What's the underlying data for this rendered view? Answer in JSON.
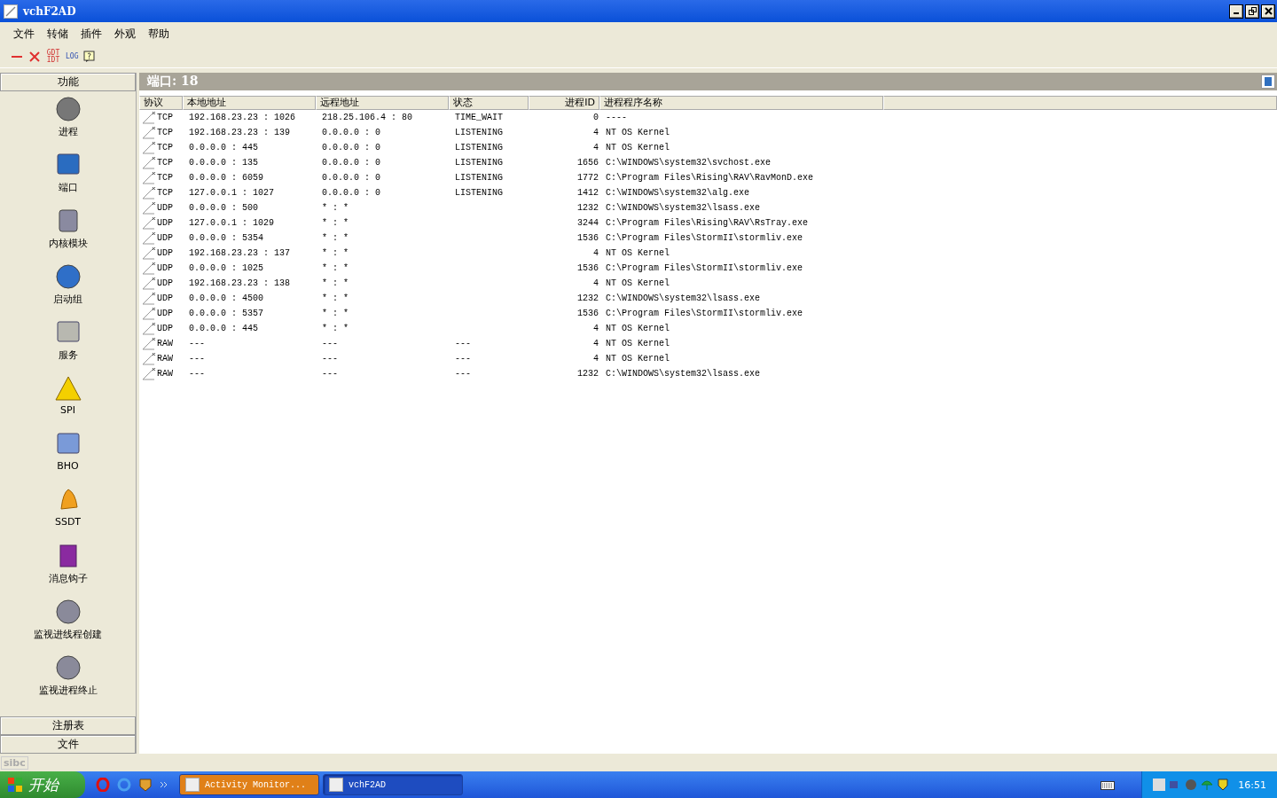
{
  "window": {
    "title": "vchF2AD"
  },
  "menu": [
    "文件",
    "转储",
    "插件",
    "外观",
    "帮助"
  ],
  "toolbar": [
    {
      "kind": "minus"
    },
    {
      "kind": "cross"
    },
    {
      "kind": "text",
      "label": "GDT IDT"
    },
    {
      "kind": "text",
      "label": "LOG"
    },
    {
      "kind": "help"
    }
  ],
  "sidebar": {
    "header": "功能",
    "items": [
      {
        "label": "进程",
        "kind": "gear"
      },
      {
        "label": "端口",
        "kind": "network"
      },
      {
        "label": "内核模块",
        "kind": "drive"
      },
      {
        "label": "启动组",
        "kind": "globe"
      },
      {
        "label": "服务",
        "kind": "computer"
      },
      {
        "label": "SPI",
        "kind": "warning"
      },
      {
        "label": "BHO",
        "kind": "folder"
      },
      {
        "label": "SSDT",
        "kind": "bell"
      },
      {
        "label": "消息钩子",
        "kind": "hook"
      },
      {
        "label": "监视进线程创建",
        "kind": "monitor"
      },
      {
        "label": "监视进程终止",
        "kind": "monitor"
      }
    ],
    "footer": [
      "注册表",
      "文件"
    ]
  },
  "panel": {
    "title": "端口: 18"
  },
  "table": {
    "columns": [
      "协议",
      "本地地址",
      "远程地址",
      "状态",
      "进程ID",
      "进程程序名称"
    ],
    "rows": [
      [
        "TCP",
        "192.168.23.23 : 1026",
        "218.25.106.4 : 80",
        "TIME_WAIT",
        "0",
        "----"
      ],
      [
        "TCP",
        "192.168.23.23 : 139",
        "0.0.0.0 : 0",
        "LISTENING",
        "4",
        "NT OS Kernel"
      ],
      [
        "TCP",
        "0.0.0.0 : 445",
        "0.0.0.0 : 0",
        "LISTENING",
        "4",
        "NT OS Kernel"
      ],
      [
        "TCP",
        "0.0.0.0 : 135",
        "0.0.0.0 : 0",
        "LISTENING",
        "1656",
        "C:\\WINDOWS\\system32\\svchost.exe"
      ],
      [
        "TCP",
        "0.0.0.0 : 6059",
        "0.0.0.0 : 0",
        "LISTENING",
        "1772",
        "C:\\Program Files\\Rising\\RAV\\RavMonD.exe"
      ],
      [
        "TCP",
        "127.0.0.1 : 1027",
        "0.0.0.0 : 0",
        "LISTENING",
        "1412",
        "C:\\WINDOWS\\system32\\alg.exe"
      ],
      [
        "UDP",
        "0.0.0.0 : 500",
        "* : *",
        "",
        "1232",
        "C:\\WINDOWS\\system32\\lsass.exe"
      ],
      [
        "UDP",
        "127.0.0.1 : 1029",
        "* : *",
        "",
        "3244",
        "C:\\Program Files\\Rising\\RAV\\RsTray.exe"
      ],
      [
        "UDP",
        "0.0.0.0 : 5354",
        "* : *",
        "",
        "1536",
        "C:\\Program Files\\StormII\\stormliv.exe"
      ],
      [
        "UDP",
        "192.168.23.23 : 137",
        "* : *",
        "",
        "4",
        "NT OS Kernel"
      ],
      [
        "UDP",
        "0.0.0.0 : 1025",
        "* : *",
        "",
        "1536",
        "C:\\Program Files\\StormII\\stormliv.exe"
      ],
      [
        "UDP",
        "192.168.23.23 : 138",
        "* : *",
        "",
        "4",
        "NT OS Kernel"
      ],
      [
        "UDP",
        "0.0.0.0 : 4500",
        "* : *",
        "",
        "1232",
        "C:\\WINDOWS\\system32\\lsass.exe"
      ],
      [
        "UDP",
        "0.0.0.0 : 5357",
        "* : *",
        "",
        "1536",
        "C:\\Program Files\\StormII\\stormliv.exe"
      ],
      [
        "UDP",
        "0.0.0.0 : 445",
        "* : *",
        "",
        "4",
        "NT OS Kernel"
      ],
      [
        "RAW",
        "---",
        "---",
        "---",
        "4",
        "NT OS Kernel"
      ],
      [
        "RAW",
        "---",
        "---",
        "---",
        "4",
        "NT OS Kernel"
      ],
      [
        "RAW",
        "---",
        "---",
        "---",
        "1232",
        "C:\\WINDOWS\\system32\\lsass.exe"
      ]
    ]
  },
  "status_bar": "sibc",
  "taskbar": {
    "start": "开始",
    "tasks": [
      {
        "label": "Activity Monitor...",
        "flashing": true,
        "selected": false
      },
      {
        "label": "vchF2AD",
        "flashing": false,
        "selected": true
      }
    ],
    "clock": "16:51"
  }
}
